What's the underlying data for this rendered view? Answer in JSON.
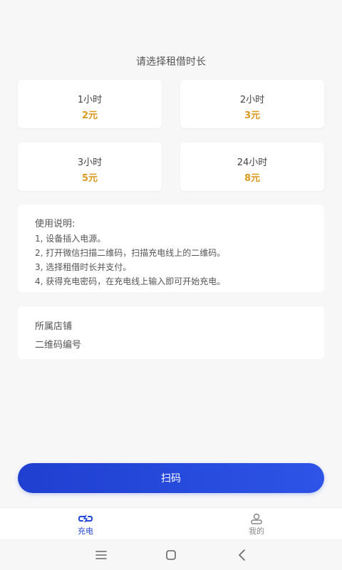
{
  "page": {
    "title": "请选择租借时长"
  },
  "plans": [
    {
      "duration": "1小时",
      "price": "2元"
    },
    {
      "duration": "2小时",
      "price": "3元"
    },
    {
      "duration": "3小时",
      "price": "5元"
    },
    {
      "duration": "24小时",
      "price": "8元"
    }
  ],
  "instructions": {
    "heading": "使用说明:",
    "steps": [
      "1, 设备插入电源。",
      "2, 打开微信扫描二维码，扫描充电线上的二维码。",
      "3, 选择租借时长并支付。",
      "4, 获得充电密码，在充电线上输入即可开始充电。"
    ]
  },
  "store": {
    "store_label": "所属店铺",
    "qrcode_label": "二维码编号"
  },
  "scan_button": {
    "label": "扫码"
  },
  "tabbar": {
    "items": [
      {
        "label": "充电",
        "icon": "charge-icon",
        "active": true
      },
      {
        "label": "我的",
        "icon": "user-icon",
        "active": false
      }
    ]
  },
  "colors": {
    "accent": "#2246d8",
    "price": "#d99a1e",
    "background": "#f7f7f8"
  }
}
